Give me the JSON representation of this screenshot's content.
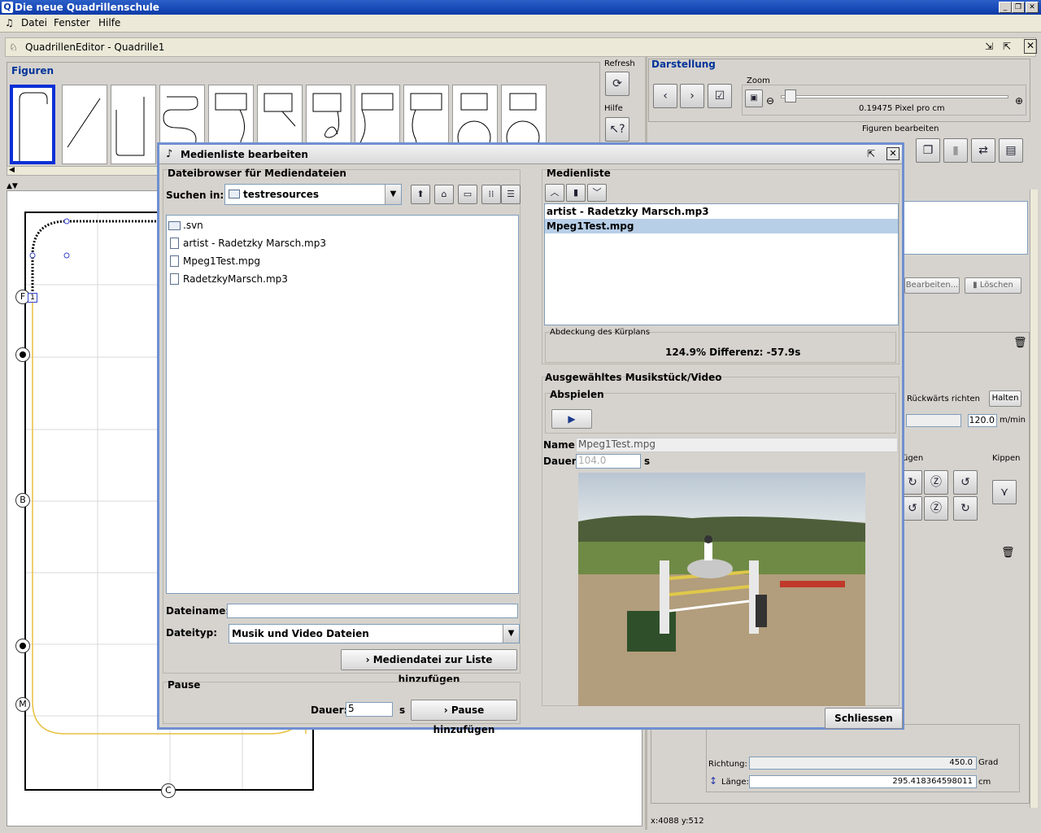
{
  "app": {
    "title": "Die neue Quadrillenschule",
    "icon_letter": "Q"
  },
  "menu": [
    "Datei",
    "Fenster",
    "Hilfe"
  ],
  "editor": {
    "title": "QuadrillenEditor - Quadrille1"
  },
  "figuren": {
    "title": "Figuren"
  },
  "side_tools": {
    "refresh": "Refresh",
    "hilfe": "Hilfe"
  },
  "darstellung": {
    "title": "Darstellung",
    "zoom_label": "Zoom",
    "zoom_value": "0.19475 Pixel pro cm",
    "zoom_level": 0.02
  },
  "figuren_bearbeiten": {
    "title": "Figuren bearbeiten"
  },
  "right_panel": {
    "bearbeiten": "Bearbeiten...",
    "loeschen": "Löschen",
    "rueckwaerts": "Rückwärts richten",
    "halten": "Halten",
    "tempo_value": "120.0",
    "tempo_unit": "m/min",
    "fuegen_label": "ügen",
    "kippen_label": "Kippen",
    "richtung_label": "Richtung:",
    "richtung_value": "450.0",
    "richtung_unit": "Grad",
    "laenge_label": "Länge:",
    "laenge_value": "295.418364598011",
    "laenge_unit": "cm"
  },
  "arena_markers": [
    "F",
    "B",
    "M",
    "C"
  ],
  "marker_one": "1",
  "status": {
    "coords": "x:4088 y:512"
  },
  "dialog": {
    "title": "Medienliste bearbeiten",
    "browser": {
      "title": "Dateibrowser für Mediendateien",
      "suchen_label": "Suchen in:",
      "suchen_value": "testresources",
      "files": [
        {
          "name": ".svn",
          "type": "folder"
        },
        {
          "name": "artist - Radetzky Marsch.mp3",
          "type": "file"
        },
        {
          "name": "Mpeg1Test.mpg",
          "type": "file"
        },
        {
          "name": "RadetzkyMarsch.mp3",
          "type": "file"
        }
      ],
      "dateiname_label": "Dateiname:",
      "dateiname_value": "",
      "dateityp_label": "Dateityp:",
      "dateityp_value": "Musik und Video Dateien",
      "add_button": "Mediendatei zur Liste hinzufügen"
    },
    "pause": {
      "title": "Pause",
      "dauer_label": "Dauer:",
      "dauer_value": "5",
      "unit": "s",
      "add_button": "Pause hinzufügen"
    },
    "medienliste": {
      "title": "Medienliste",
      "items": [
        "artist - Radetzky Marsch.mp3",
        "Mpeg1Test.mpg"
      ],
      "selected_index": 1
    },
    "abdeckung": {
      "title": "Abdeckung des Kürplans",
      "value": "124.9% Differenz: -57.9s"
    },
    "selected": {
      "title": "Ausgewähltes Musikstück/Video",
      "abspielen": "Abspielen",
      "name_label": "Name:",
      "name_value": "Mpeg1Test.mpg",
      "dauer_label": "Dauer:",
      "dauer_value": "104.0",
      "dauer_unit": "s"
    },
    "close_button": "Schliessen"
  }
}
